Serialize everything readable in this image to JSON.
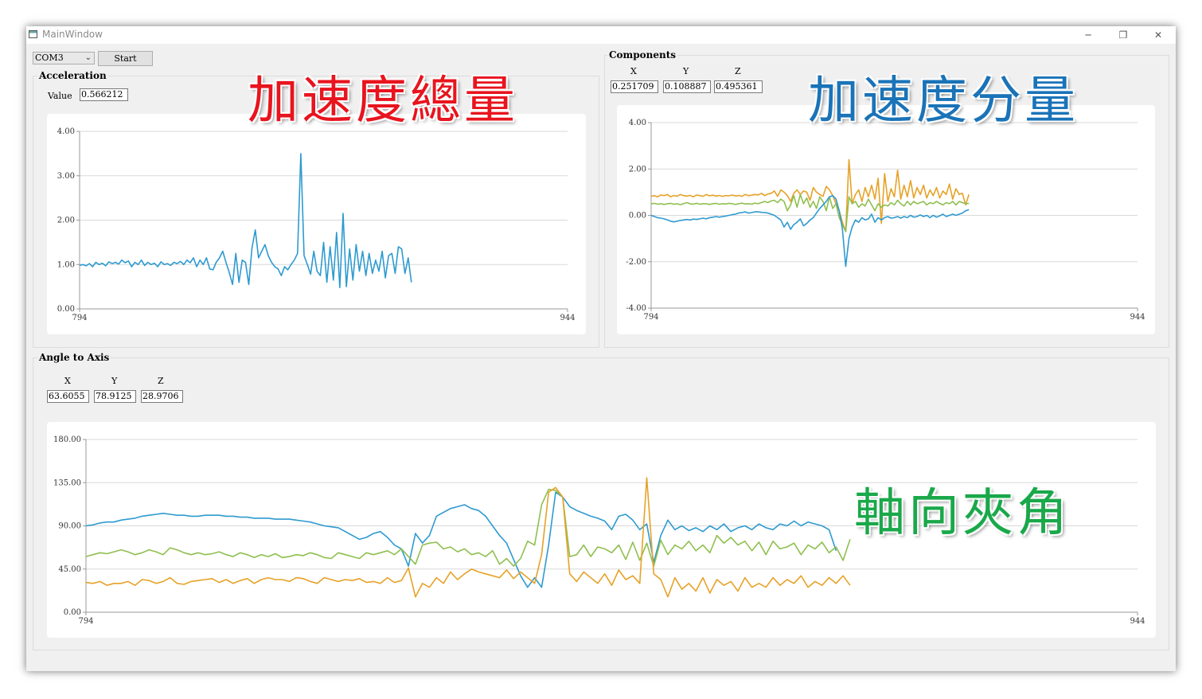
{
  "window": {
    "title": "MainWindow"
  },
  "toolbar": {
    "port_value": "COM3",
    "start_label": "Start"
  },
  "acceleration": {
    "group_label": "Acceleration",
    "value_label": "Value",
    "value": "0.566212"
  },
  "components": {
    "group_label": "Components",
    "x_label": "X",
    "y_label": "Y",
    "z_label": "Z",
    "x_value": "0.251709",
    "y_value": "0.108887",
    "z_value": "0.495361"
  },
  "angle": {
    "group_label": "Angle to Axis",
    "x_label": "X",
    "y_label": "Y",
    "z_label": "Z",
    "x_value": "63.6055",
    "y_value": "78.9125",
    "z_value": "28.9706"
  },
  "overlays": {
    "total": "加速度總量",
    "components": "加速度分量",
    "angle": "軸向夾角"
  },
  "colors": {
    "overlay_total": "#e8141e",
    "overlay_components": "#1a73b8",
    "overlay_angle": "#1aa84a",
    "series_blue": "#2e9ad0",
    "series_green": "#8fbf4f",
    "series_orange": "#e6a228"
  },
  "chart_data": [
    {
      "type": "line",
      "name": "acceleration",
      "xlim": [
        794,
        944
      ],
      "ylim": [
        0,
        4
      ],
      "x_tick_labels": [
        "794",
        "944"
      ],
      "y_tick_labels": [
        "4.00",
        "3.00",
        "2.00",
        "1.00",
        "0.00"
      ],
      "series": [
        {
          "color": "#2e9ad0",
          "x_start": 794,
          "x_step": 1,
          "values": [
            0.98,
            1.0,
            0.97,
            1.02,
            0.95,
            1.05,
            1.0,
            1.03,
            0.97,
            1.06,
            1.02,
            1.05,
            1.01,
            1.1,
            1.04,
            1.08,
            0.95,
            1.05,
            1.0,
            1.1,
            0.98,
            1.05,
            1.0,
            1.03,
            0.95,
            1.06,
            1.0,
            1.02,
            0.98,
            1.05,
            1.02,
            1.07,
            1.0,
            1.1,
            1.04,
            1.15,
            0.95,
            1.1,
            1.0,
            1.15,
            0.9,
            0.88,
            1.05,
            1.15,
            1.3,
            1.05,
            0.82,
            0.55,
            1.25,
            0.6,
            1.1,
            1.05,
            0.55,
            1.38,
            1.78,
            1.15,
            1.3,
            1.45,
            1.2,
            1.05,
            0.95,
            0.9,
            0.75,
            0.95,
            0.88,
            1.0,
            1.1,
            1.25,
            3.5,
            1.2,
            1.0,
            0.78,
            1.3,
            0.85,
            0.75,
            1.5,
            0.6,
            1.4,
            0.65,
            1.72,
            0.48,
            2.15,
            0.5,
            1.35,
            0.65,
            1.45,
            0.85,
            1.3,
            0.75,
            1.25,
            0.8,
            1.1,
            0.85,
            1.3,
            0.7,
            1.2,
            1.25,
            0.8,
            1.4,
            1.35,
            0.8,
            1.15,
            0.6
          ]
        }
      ]
    },
    {
      "type": "line",
      "name": "components",
      "xlim": [
        794,
        944
      ],
      "ylim": [
        -4,
        4
      ],
      "x_tick_labels": [
        "794",
        "944"
      ],
      "y_tick_labels": [
        "4.00",
        "2.00",
        "0.00",
        "-2.00",
        "-4.00"
      ],
      "series": [
        {
          "color": "#e6a228",
          "x_start": 794,
          "x_step": 1,
          "values": [
            0.82,
            0.85,
            0.8,
            0.88,
            0.85,
            0.9,
            0.8,
            0.86,
            0.82,
            0.9,
            0.85,
            0.83,
            0.86,
            0.8,
            0.88,
            0.85,
            0.82,
            0.9,
            0.84,
            0.87,
            0.83,
            0.86,
            0.82,
            0.85,
            0.84,
            0.88,
            0.83,
            0.86,
            0.82,
            0.9,
            0.85,
            0.87,
            0.9,
            0.88,
            0.95,
            0.85,
            0.92,
            0.95,
            1.05,
            0.82,
            1.1,
            1.0,
            0.85,
            0.6,
            0.95,
            1.1,
            0.9,
            1.05,
            1.0,
            0.65,
            1.2,
            1.0,
            0.9,
            0.82,
            1.25,
            1.1,
            0.85,
            0.5,
            0.2,
            -0.3,
            -0.7,
            2.4,
            0.5,
            0.9,
            1.1,
            0.6,
            1.2,
            0.8,
            1.3,
            0.7,
            1.6,
            -0.35,
            1.8,
            0.6,
            1.15,
            0.8,
            1.95,
            0.7,
            1.3,
            0.8,
            1.5,
            0.75,
            1.2,
            0.9,
            1.3,
            0.75,
            1.1,
            0.85,
            1.2,
            0.75,
            1.05,
            0.9,
            1.35,
            0.7,
            1.15,
            0.9,
            0.95,
            0.45,
            0.9
          ]
        },
        {
          "color": "#8fbf4f",
          "x_start": 794,
          "x_step": 1,
          "values": [
            0.5,
            0.52,
            0.48,
            0.5,
            0.47,
            0.5,
            0.52,
            0.48,
            0.5,
            0.46,
            0.5,
            0.55,
            0.5,
            0.48,
            0.52,
            0.48,
            0.5,
            0.5,
            0.47,
            0.5,
            0.52,
            0.48,
            0.5,
            0.49,
            0.52,
            0.5,
            0.47,
            0.5,
            0.53,
            0.49,
            0.5,
            0.48,
            0.53,
            0.5,
            0.55,
            0.6,
            0.55,
            0.62,
            0.65,
            0.55,
            0.7,
            0.6,
            0.2,
            0.45,
            0.85,
            0.35,
            0.9,
            0.5,
            0.75,
            0.35,
            0.6,
            0.3,
            0.8,
            0.6,
            0.2,
            0.8,
            0.3,
            0.5,
            -0.1,
            -0.4,
            -0.7,
            0.8,
            0.5,
            0.6,
            0.35,
            0.5,
            0.4,
            0.7,
            0.45,
            0.2,
            0.5,
            0.35,
            0.45,
            0.4,
            0.55,
            0.45,
            0.65,
            0.5,
            0.4,
            0.6,
            0.45,
            0.6,
            0.5,
            0.55,
            0.6,
            0.45,
            0.55,
            0.5,
            0.6,
            0.52,
            0.45,
            0.55,
            0.5,
            0.6,
            0.45,
            0.6,
            0.55,
            0.5,
            0.52
          ]
        },
        {
          "color": "#2e9ad0",
          "x_start": 794,
          "x_step": 1,
          "values": [
            0.0,
            -0.05,
            -0.1,
            -0.12,
            -0.15,
            -0.2,
            -0.25,
            -0.28,
            -0.25,
            -0.22,
            -0.2,
            -0.18,
            -0.2,
            -0.16,
            -0.18,
            -0.15,
            -0.12,
            -0.15,
            -0.1,
            -0.08,
            -0.05,
            -0.08,
            -0.05,
            -0.03,
            0.0,
            0.03,
            0.05,
            0.1,
            0.12,
            0.15,
            0.1,
            0.12,
            0.15,
            0.15,
            0.13,
            0.12,
            0.1,
            0.05,
            0.0,
            -0.1,
            -0.2,
            -0.5,
            -0.3,
            -0.6,
            -0.4,
            -0.3,
            -0.15,
            -0.45,
            -0.35,
            -0.2,
            -0.1,
            0.1,
            0.3,
            0.45,
            0.6,
            0.8,
            0.85,
            0.7,
            0.2,
            -0.6,
            -2.2,
            -1.0,
            -0.5,
            -0.2,
            -0.3,
            -0.1,
            -0.2,
            -0.15,
            0.05,
            -0.3,
            -0.1,
            -0.2,
            -0.1,
            -0.05,
            -0.12,
            -0.1,
            -0.05,
            -0.12,
            -0.05,
            -0.1,
            0.0,
            -0.08,
            -0.05,
            0.02,
            -0.05,
            0.0,
            -0.1,
            0.0,
            -0.08,
            -0.02,
            0.05,
            -0.05,
            0.0,
            0.05,
            0.0,
            0.05,
            0.1,
            0.2,
            0.25
          ]
        }
      ]
    },
    {
      "type": "line",
      "name": "angle-to-axis",
      "xlim": [
        794,
        944
      ],
      "ylim": [
        0,
        180
      ],
      "x_tick_labels": [
        "794",
        "944"
      ],
      "y_tick_labels": [
        "180.00",
        "135.00",
        "90.00",
        "45.00",
        "0.00"
      ],
      "series": [
        {
          "color": "#2e9ad0",
          "x_start": 794,
          "x_step": 1,
          "values": [
            90,
            91,
            93,
            94,
            94,
            96,
            97,
            98,
            100,
            101,
            102,
            103,
            102,
            101,
            101,
            100,
            100,
            101,
            101,
            101,
            100,
            100,
            99,
            99,
            98,
            98,
            98,
            97,
            97,
            97,
            96,
            95,
            94,
            92,
            90,
            89,
            88,
            84,
            80,
            76,
            78,
            82,
            84,
            78,
            70,
            66,
            48,
            82,
            72,
            80,
            100,
            104,
            108,
            110,
            112,
            108,
            106,
            100,
            90,
            80,
            72,
            55,
            38,
            26,
            36,
            26,
            70,
            125,
            120,
            110,
            106,
            103,
            100,
            98,
            95,
            86,
            100,
            102,
            96,
            86,
            92,
            52,
            80,
            96,
            86,
            90,
            85,
            88,
            84,
            90,
            86,
            92,
            84,
            88,
            90,
            86,
            92,
            88,
            86,
            92,
            90,
            95,
            90,
            94,
            92,
            90,
            86,
            64
          ]
        },
        {
          "color": "#8fbf4f",
          "x_start": 794,
          "x_step": 1,
          "values": [
            58,
            60,
            62,
            61,
            63,
            65,
            63,
            60,
            62,
            65,
            63,
            60,
            67,
            65,
            62,
            60,
            62,
            60,
            61,
            63,
            60,
            58,
            62,
            60,
            57,
            60,
            58,
            61,
            57,
            58,
            60,
            59,
            62,
            60,
            57,
            56,
            62,
            60,
            58,
            56,
            62,
            60,
            62,
            64,
            60,
            66,
            58,
            50,
            70,
            72,
            73,
            66,
            68,
            63,
            66,
            60,
            62,
            58,
            64,
            50,
            56,
            48,
            56,
            74,
            70,
            112,
            128,
            127,
            120,
            58,
            60,
            70,
            58,
            68,
            66,
            62,
            70,
            55,
            73,
            54,
            72,
            48,
            75,
            60,
            70,
            66,
            74,
            64,
            70,
            62,
            80,
            72,
            78,
            70,
            74,
            64,
            73,
            60,
            74,
            66,
            68,
            72,
            60,
            70,
            66,
            73,
            62,
            68,
            54,
            76
          ]
        },
        {
          "color": "#e6a228",
          "x_start": 794,
          "x_step": 1,
          "values": [
            31,
            30,
            32,
            28,
            30,
            30,
            32,
            28,
            34,
            33,
            30,
            32,
            36,
            30,
            29,
            32,
            33,
            34,
            35,
            31,
            34,
            30,
            33,
            35,
            30,
            34,
            36,
            34,
            34,
            32,
            36,
            35,
            32,
            30,
            36,
            34,
            32,
            34,
            33,
            35,
            31,
            32,
            30,
            36,
            31,
            33,
            46,
            16,
            30,
            26,
            36,
            30,
            42,
            34,
            40,
            45,
            42,
            40,
            38,
            36,
            44,
            35,
            42,
            36,
            30,
            60,
            125,
            130,
            120,
            40,
            32,
            42,
            36,
            30,
            40,
            28,
            44,
            34,
            38,
            30,
            140,
            40,
            34,
            16,
            36,
            24,
            30,
            22,
            36,
            20,
            34,
            28,
            32,
            22,
            36,
            26,
            30,
            26,
            36,
            28,
            34,
            30,
            38,
            26,
            32,
            28,
            36,
            30,
            38,
            28
          ]
        }
      ]
    }
  ]
}
